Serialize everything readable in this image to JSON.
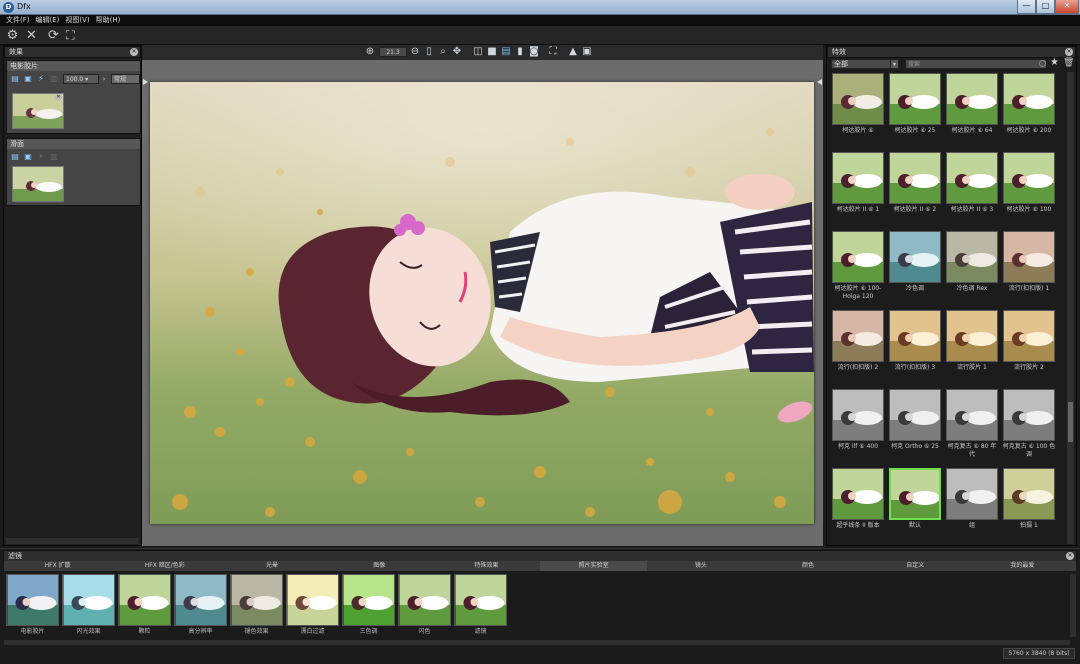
{
  "window": {
    "title": "Dfx",
    "min": "—",
    "max": "□",
    "close": "✕"
  },
  "menu": [
    "文件(F)",
    "编辑(E)",
    "视图(V)",
    "帮助(H)"
  ],
  "toolbar_icons": [
    "gear-icon",
    "cancel-icon",
    "refresh-icon",
    "fit-icon"
  ],
  "left": {
    "header": "效果",
    "fx1": {
      "title": "电影胶片",
      "value": "100.0",
      "mode": "常规"
    },
    "fx2": {
      "title": "滑面"
    }
  },
  "viewer": {
    "zoom": "21.3"
  },
  "right": {
    "header": "特效",
    "filter": "全部",
    "search": "搜索",
    "presets": [
      "柯达胶片 ⑥",
      "柯达胶片 ⑥ 25",
      "柯达胶片 ⑥ 64",
      "柯达胶片 ⑥ 200",
      "柯达胶片 II ⑥ 1",
      "柯达胶片 II ⑥ 2",
      "柯达胶片 II ⑥ 3",
      "柯达胶片 ⑥ 100",
      "柯达胶片 ⑥ 100-Holga 120",
      "冷色调",
      "冷色调 Rex",
      "流行(扣扣版) 1",
      "流行(扣扣版) 2",
      "流行(扣扣版) 3",
      "流行胶片 1",
      "流行胶片 2",
      "柯克 Ilf ⑥ 400",
      "柯克 Ortho ⑥ 25",
      "柯克复古 ⑥ 80 年代",
      "柯克复古 ⑥ 100 色调",
      "超乎线条 II 版本",
      "默认",
      "组",
      "拍摄 1"
    ]
  },
  "bottom": {
    "header": "滤镜",
    "tabs": [
      "HFX 扩散",
      "HFX 暗区/色彩",
      "光晕",
      "图像",
      "特殊效果",
      "照片实验室",
      "镜头",
      "颜色",
      "自定义",
      "我的最爱"
    ],
    "active_tab": 5,
    "thumbs": [
      "电影胶片",
      "闪光效果",
      "颗粒",
      "高分辨率",
      "褪色效果",
      "漂白过滤",
      "三色调",
      "闪色",
      "滤镜"
    ]
  },
  "status": "5760 x 3840 (8 bits)"
}
